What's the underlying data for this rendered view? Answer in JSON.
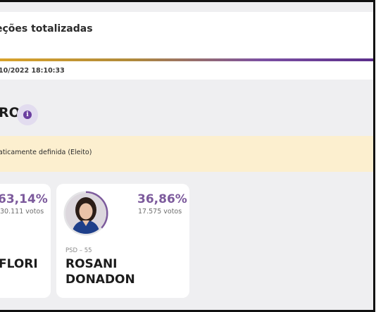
{
  "header": {
    "title": "eções totalizadas",
    "timestamp": "10/2022 18:10:33"
  },
  "section": {
    "title": "RO",
    "info_icon": "info-icon"
  },
  "notice": {
    "text": "aticamente definida (Eleito)"
  },
  "candidates": [
    {
      "name": "FLORI",
      "percent": "63,14%",
      "votes": "30.111 votos"
    },
    {
      "name_line1": "ROSANI",
      "name_line2": "DONADON",
      "party": "PSD – 55",
      "percent": "36,86%",
      "percent_value": 36.86,
      "votes": "17.575 votos"
    }
  ],
  "colors": {
    "accent_purple": "#7c5a9c",
    "notice_bg": "#fcefcf",
    "page_bg": "#efeff1"
  }
}
